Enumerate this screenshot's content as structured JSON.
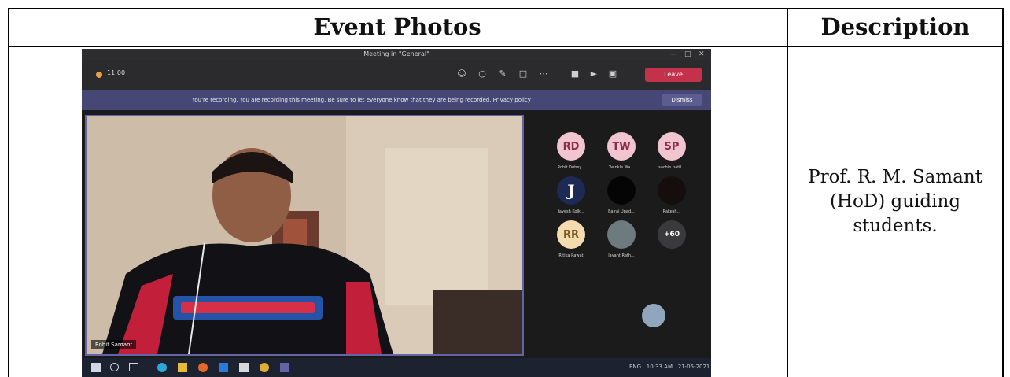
{
  "table": {
    "header_left": "Event Photos",
    "header_right": "Description",
    "description_lines": [
      "Prof. R. M. Samant",
      "(HoD) guiding",
      "students."
    ]
  },
  "screenshot": {
    "window_title": "Meeting in \"General\"",
    "timer": "11:00",
    "leave_label": "Leave",
    "banner_text": "You're recording. You are recording this meeting. Be sure to let everyone know that they are being recorded. Privacy policy",
    "dismiss_label": "Dismiss",
    "main_participant_label": "Rohit Samant",
    "participants": [
      {
        "initials": "RD",
        "name": "Rohit Dubey...",
        "color": "#f0c5cf",
        "text_color": "#8a2d49"
      },
      {
        "initials": "TW",
        "name": "Twinkle Wa...",
        "color": "#f0c5cf",
        "text_color": "#8a2d49"
      },
      {
        "initials": "SP",
        "name": "sachin patil...",
        "color": "#f0c5cf",
        "text_color": "#8a2d49"
      },
      {
        "initials": "J",
        "name": "Jayesh Kolk...",
        "color": "#1c2a55",
        "text_color": "#ffffff"
      },
      {
        "initials": "",
        "name": "Balraj Upad...",
        "color": "#050505",
        "text_color": "#ffffff"
      },
      {
        "initials": "",
        "name": "Rakesh...",
        "color": "#160d0d",
        "text_color": "#ffffff"
      },
      {
        "initials": "RR",
        "name": "Ritika Rawat",
        "color": "#f4dcb0",
        "text_color": "#7a5a20"
      },
      {
        "initials": "",
        "name": "Jayant Rath...",
        "color": "#6d7b7e",
        "text_color": "#ffffff"
      },
      {
        "initials": "+60",
        "name": "",
        "color": "#3a3a3c",
        "text_color": "#ffffff"
      }
    ],
    "tray_time": "10:33 AM",
    "tray_date": "21-05-2021",
    "tray_lang": "ENG"
  }
}
